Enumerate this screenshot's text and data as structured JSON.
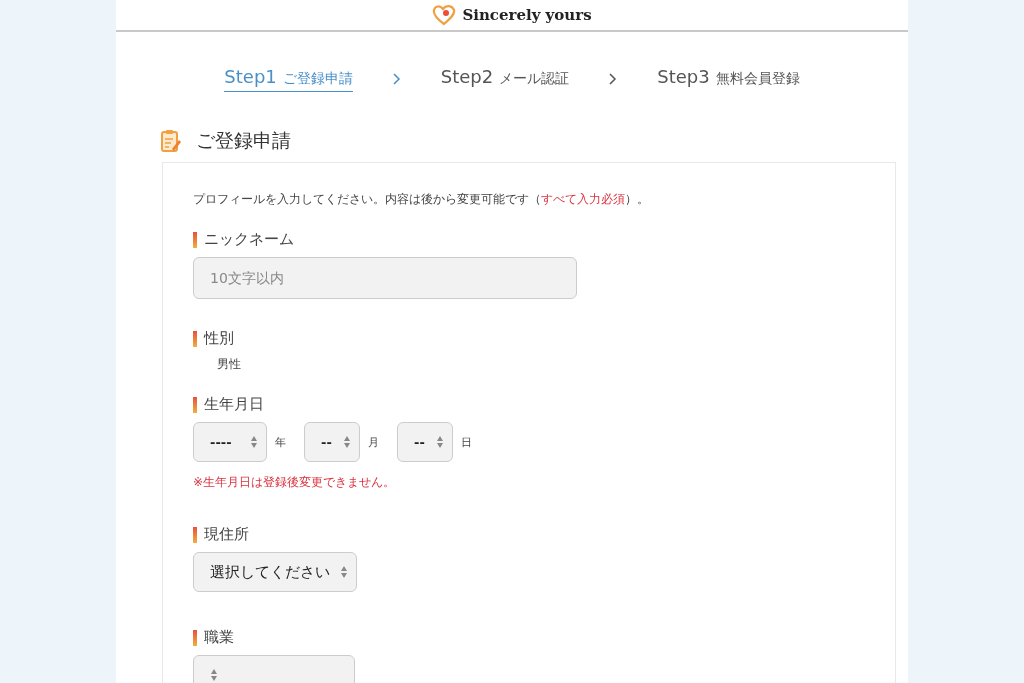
{
  "header": {
    "logo": "Sincerely yours"
  },
  "steps": [
    {
      "step": "Step1",
      "label": "ご登録申請",
      "selected": true
    },
    {
      "step": "Step2",
      "label": "メール認証",
      "selected": false
    },
    {
      "step": "Step3",
      "label": "無料会員登録",
      "selected": false
    }
  ],
  "section": {
    "title": "ご登録申請"
  },
  "form": {
    "intro": {
      "before": "プロフィールを入力してください。内容は後から変更可能です（",
      "emphasis": "すべて入力必須",
      "after": "）。"
    },
    "fields": [
      {
        "kind": "text",
        "label": "ニックネーム",
        "placeholder": "10文字以内"
      },
      {
        "kind": "static",
        "label": "性別",
        "value": "男性"
      },
      {
        "kind": "date",
        "label": "生年月日",
        "parts": [
          {
            "value": "----",
            "unit": "年"
          },
          {
            "value": "--",
            "unit": "月"
          },
          {
            "value": "--",
            "unit": "日"
          }
        ],
        "note": "※生年月日は登録後変更できません。"
      },
      {
        "kind": "select",
        "label": "現住所",
        "value": "選択してください"
      },
      {
        "kind": "select",
        "label": "職業"
      }
    ]
  }
}
